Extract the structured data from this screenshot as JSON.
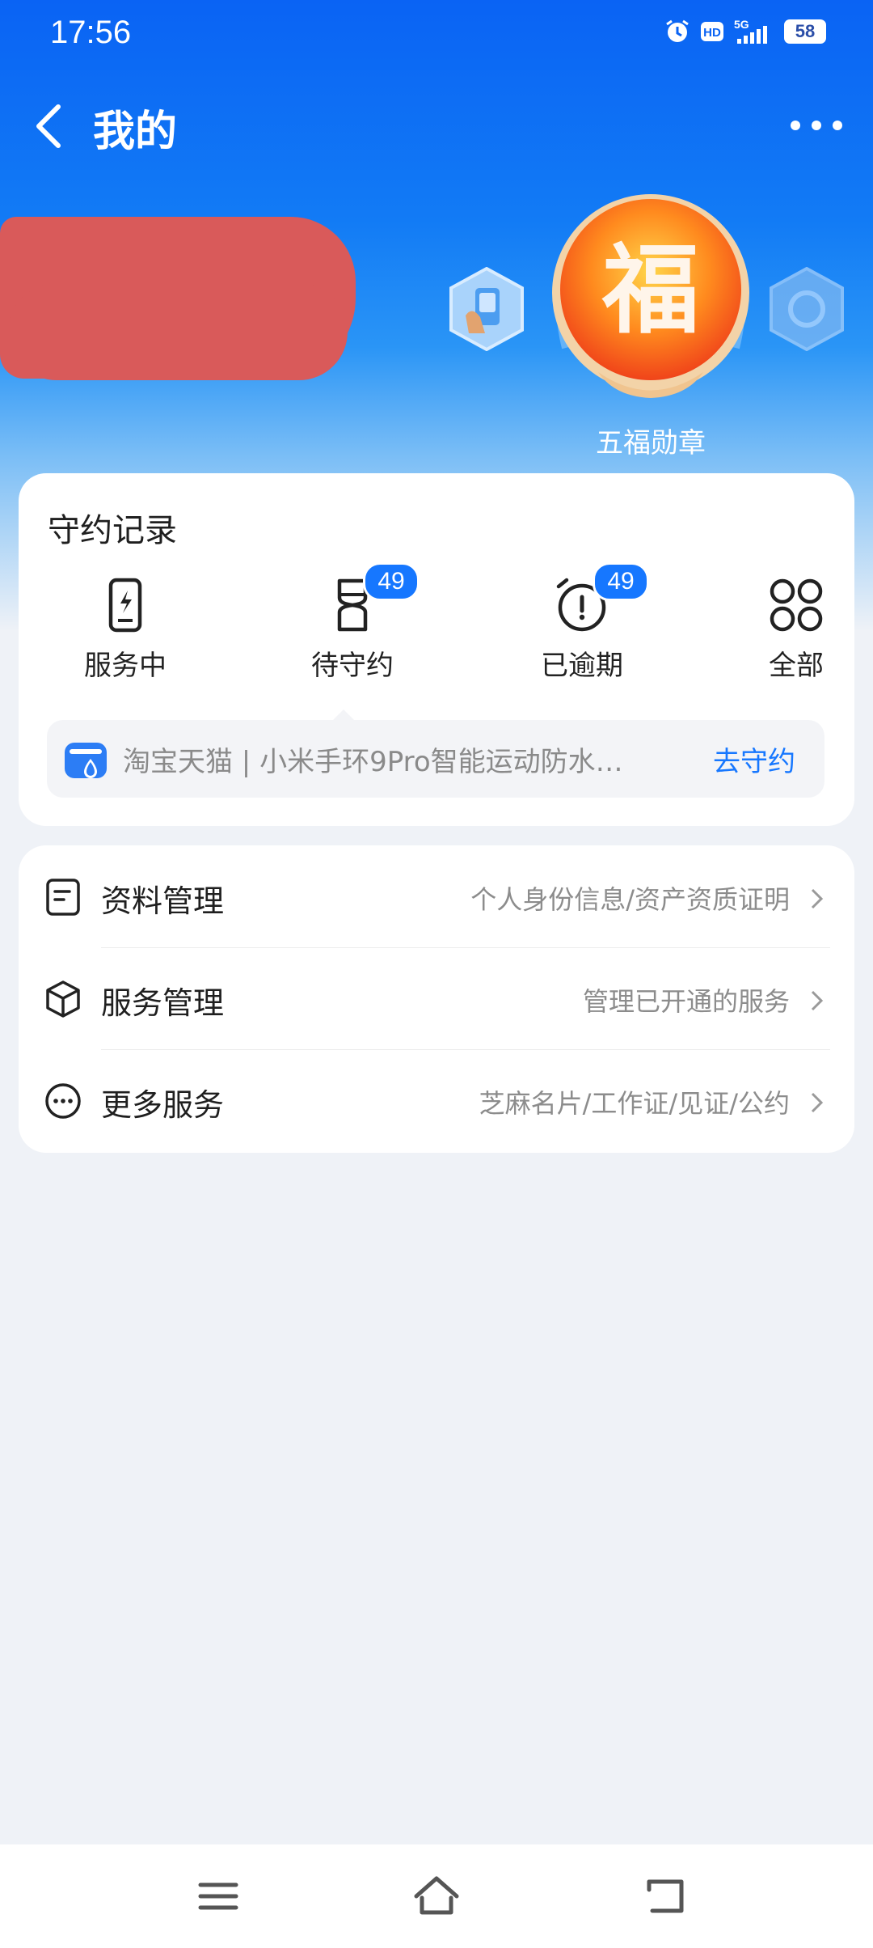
{
  "status": {
    "time": "17:56",
    "battery": "58",
    "icons": [
      "alarm-icon",
      "hd-icon",
      "5g-signal-icon",
      "battery-icon"
    ]
  },
  "topbar": {
    "title": "我的"
  },
  "profile": {
    "medal_label": "五福勋章"
  },
  "records": {
    "title": "守约记录",
    "items": [
      {
        "label": "服务中",
        "icon": "phone-lightning-icon",
        "badge": ""
      },
      {
        "label": "待守约",
        "icon": "hourglass-icon",
        "badge": "49"
      },
      {
        "label": "已逾期",
        "icon": "alarm-exclaim-icon",
        "badge": "49"
      },
      {
        "label": "全部",
        "icon": "grid-icon",
        "badge": ""
      }
    ],
    "promise": {
      "text": "淘宝天猫 | 小米手环9Pro智能运动防水…",
      "action": "去守约"
    }
  },
  "menu": [
    {
      "title": "资料管理",
      "desc": "个人身份信息/资产资质证明",
      "icon": "document-icon"
    },
    {
      "title": "服务管理",
      "desc": "管理已开通的服务",
      "icon": "cube-icon"
    },
    {
      "title": "更多服务",
      "desc": "芝麻名片/工作证/见证/公约",
      "icon": "more-circle-icon"
    }
  ],
  "colors": {
    "accent": "#1677ff",
    "hero_top": "#0a63f4",
    "background": "#eff2f7",
    "redaction": "#d95a5a"
  }
}
